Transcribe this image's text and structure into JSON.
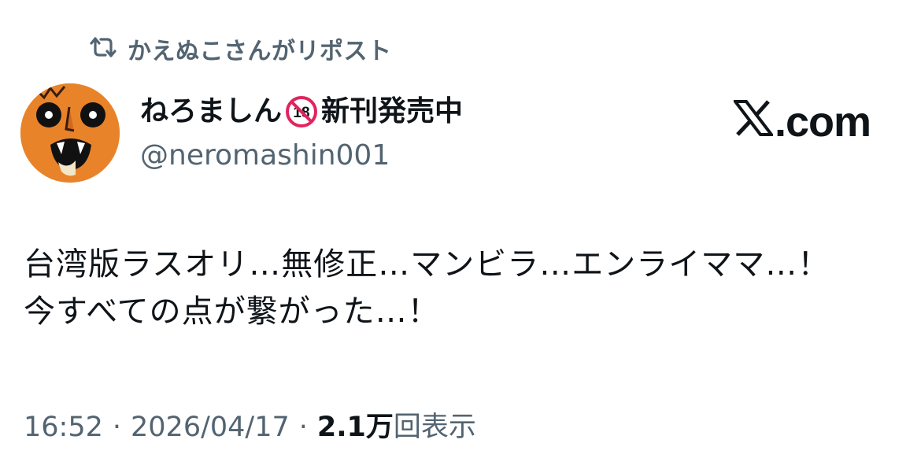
{
  "repost": {
    "icon": "repost-icon",
    "text": "かえぬこさんがリポスト"
  },
  "author": {
    "avatar_icon": "avatar",
    "display_name": "ねろましん",
    "badge_icon": "no-under-18-icon",
    "name_suffix": "新刊発売中",
    "handle": "@neromashin001"
  },
  "brand": {
    "logo_icon": "x-logo-icon",
    "domain_text": ".com"
  },
  "tweet": {
    "lines": [
      "台湾版ラスオリ…無修正…マンビラ…エンライママ…！",
      "今すべての点が繋がった…！"
    ]
  },
  "meta": {
    "time": "16:52",
    "separator": "·",
    "date": "2026/04/17",
    "views_count": "2.1万",
    "views_label": "回表示"
  },
  "colors": {
    "text_primary": "#0f1419",
    "text_secondary": "#536471",
    "avatar_orange": "#e8832a",
    "badge_red": "#e0245e"
  }
}
